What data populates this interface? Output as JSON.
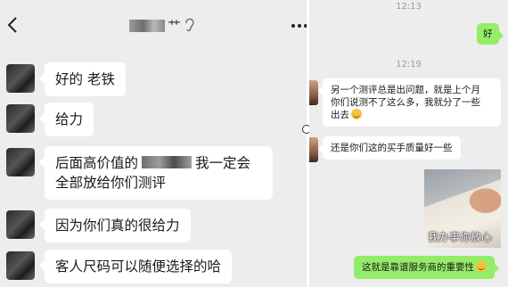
{
  "left_chat": {
    "title_fragment": "艹",
    "messages": [
      {
        "text": "好的 老铁"
      },
      {
        "text": "给力"
      },
      {
        "text_before": "后面高价值的",
        "text_after": "我一定会",
        "line2": "全部放给你们测评"
      },
      {
        "text": "因为你们真的很给力"
      },
      {
        "text": "客人尺码可以随便选择的哈"
      }
    ]
  },
  "right_chat": {
    "timestamps": [
      "12:13",
      "12:19"
    ],
    "msg_ok": "好",
    "msg_long": {
      "line1": "另一个测评总是出问题，就是上个月",
      "line2": "你们说测不了这么多，我就分了一些",
      "line3": "出去"
    },
    "msg_quality": "还是你们这的买手质量好一些",
    "photo_caption": "我办事你放心",
    "msg_final": "这就是靠谱服务商的重要性"
  },
  "colors": {
    "chat_bg": "#ededed",
    "bubble_other": "#ffffff",
    "bubble_self": "#95ec69"
  }
}
